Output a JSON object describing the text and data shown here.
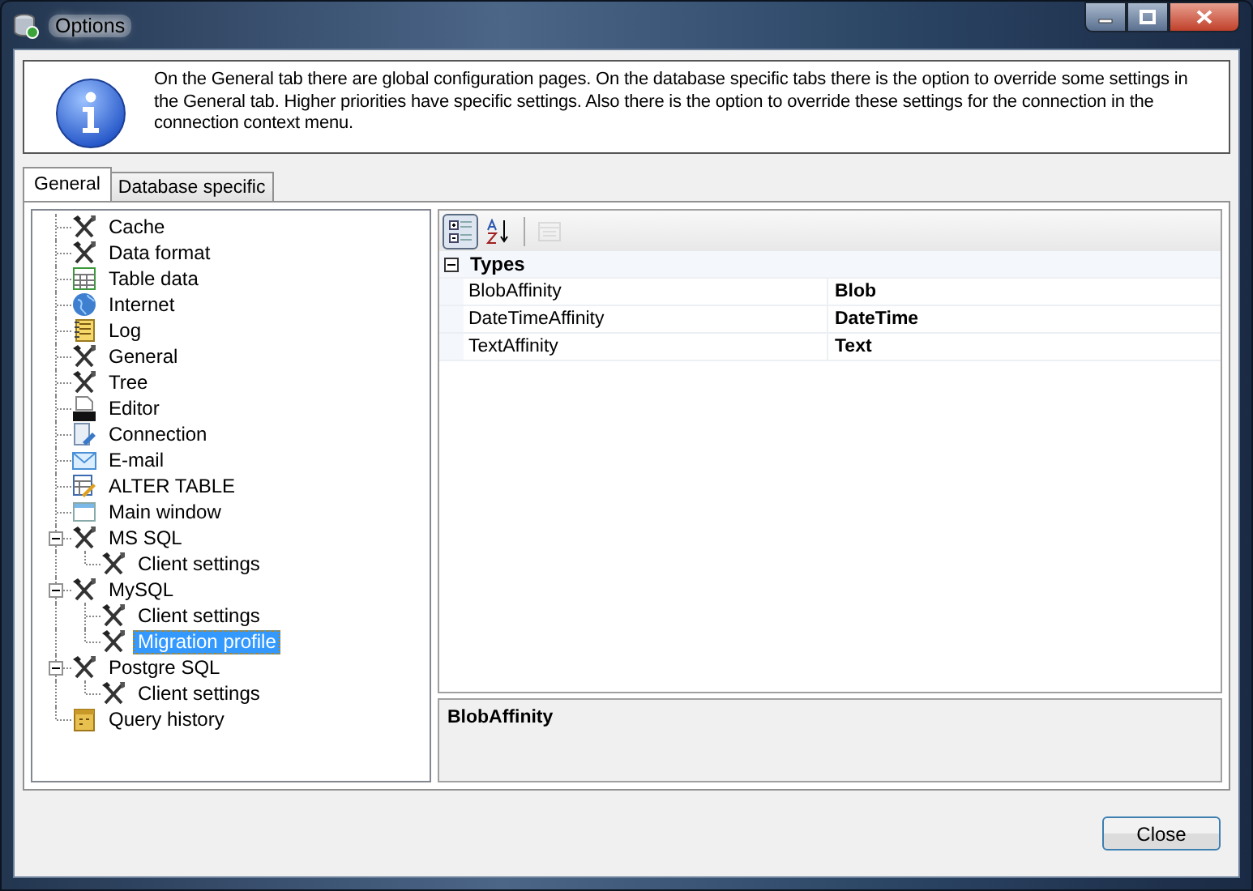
{
  "window": {
    "title": "Options"
  },
  "info": {
    "text": "On the General tab there are global configuration pages. On the database specific tabs there is the option to override some settings in the General tab. Higher priorities have specific settings. Also there is the option to override these settings for the connection in the connection context menu."
  },
  "tabs": [
    {
      "label": "General",
      "selected": true
    },
    {
      "label": "Database specific",
      "selected": false
    }
  ],
  "tree": [
    {
      "label": "Cache",
      "kind": "tools",
      "selected": false
    },
    {
      "label": "Data format",
      "kind": "tools",
      "selected": false
    },
    {
      "label": "Table data",
      "kind": "table",
      "selected": false
    },
    {
      "label": "Internet",
      "kind": "globe",
      "selected": false
    },
    {
      "label": "Log",
      "kind": "log",
      "selected": false
    },
    {
      "label": "General",
      "kind": "tools",
      "selected": false
    },
    {
      "label": "Tree",
      "kind": "tools",
      "selected": false
    },
    {
      "label": "Editor",
      "kind": "sql",
      "selected": false
    },
    {
      "label": "Connection",
      "kind": "connection",
      "selected": false
    },
    {
      "label": "E-mail",
      "kind": "email",
      "selected": false
    },
    {
      "label": "ALTER TABLE",
      "kind": "alter",
      "selected": false
    },
    {
      "label": "Main window",
      "kind": "window",
      "selected": false
    },
    {
      "label": "MS SQL",
      "kind": "tools",
      "selected": false,
      "expanded": true,
      "children": [
        {
          "label": "Client settings",
          "kind": "tools",
          "selected": false
        }
      ]
    },
    {
      "label": "MySQL",
      "kind": "tools",
      "selected": false,
      "expanded": true,
      "children": [
        {
          "label": "Client settings",
          "kind": "tools",
          "selected": false
        },
        {
          "label": "Migration profile",
          "kind": "tools",
          "selected": true
        }
      ]
    },
    {
      "label": "Postgre SQL",
      "kind": "tools",
      "selected": false,
      "expanded": true,
      "children": [
        {
          "label": "Client settings",
          "kind": "tools",
          "selected": false
        }
      ]
    },
    {
      "label": "Query history",
      "kind": "history",
      "selected": false
    }
  ],
  "toolbar": [
    {
      "kind": "categorized",
      "selected": true,
      "disabled": false
    },
    {
      "kind": "alphabetical",
      "selected": false,
      "disabled": false
    },
    {
      "kind": "pages",
      "selected": false,
      "disabled": true
    }
  ],
  "property_grid": {
    "categories": [
      {
        "name": "Types",
        "expanded": true,
        "properties": [
          {
            "name": "BlobAffinity",
            "value": "Blob"
          },
          {
            "name": "DateTimeAffinity",
            "value": "DateTime"
          },
          {
            "name": "TextAffinity",
            "value": "Text"
          }
        ]
      }
    ],
    "description": {
      "title": "BlobAffinity"
    }
  },
  "buttons": [
    {
      "label": "Close"
    }
  ]
}
